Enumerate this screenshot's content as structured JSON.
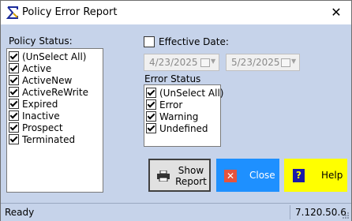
{
  "window": {
    "title": "Policy Error Report",
    "icon": "sigma-app-icon",
    "close_glyph": "✕"
  },
  "policy_status": {
    "label": "Policy Status:",
    "items": [
      {
        "label": "(UnSelect All)",
        "checked": true
      },
      {
        "label": "Active",
        "checked": true
      },
      {
        "label": "ActiveNew",
        "checked": true
      },
      {
        "label": "ActiveReWrite",
        "checked": true
      },
      {
        "label": "Expired",
        "checked": true
      },
      {
        "label": "Inactive",
        "checked": true
      },
      {
        "label": "Prospect",
        "checked": true
      },
      {
        "label": "Terminated",
        "checked": true
      }
    ]
  },
  "effective_date": {
    "label": "Effective Date:",
    "checked": false,
    "from": "4/23/2025",
    "to": "5/23/2025"
  },
  "error_status": {
    "label": "Error Status",
    "items": [
      {
        "label": "(UnSelect All)",
        "checked": true
      },
      {
        "label": "Error",
        "checked": true
      },
      {
        "label": "Warning",
        "checked": true
      },
      {
        "label": "Undefined",
        "checked": true
      }
    ]
  },
  "buttons": {
    "show_report_line1": "Show",
    "show_report_line2": "Report",
    "close": "Close",
    "close_glyph": "✕",
    "help": "Help",
    "help_glyph": "?"
  },
  "status": {
    "text": "Ready",
    "version": "7.120.50.6"
  },
  "colors": {
    "background": "#c6d3ea",
    "close_button": "#1e90ff",
    "help_button": "#ffff00"
  }
}
